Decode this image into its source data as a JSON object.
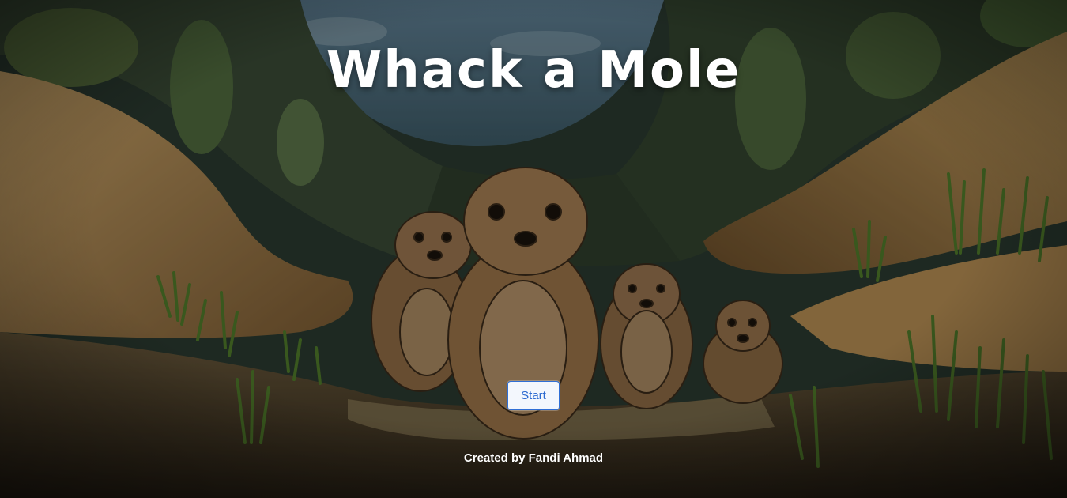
{
  "game": {
    "title": "Whack a Mole",
    "start_label": "Start",
    "credit": "Created by Fandi Ahmad"
  },
  "colors": {
    "title_text": "#ffffff",
    "button_border": "#2f6fd6",
    "button_text": "#2c6ad0",
    "button_bg": "#f3f7fd"
  }
}
